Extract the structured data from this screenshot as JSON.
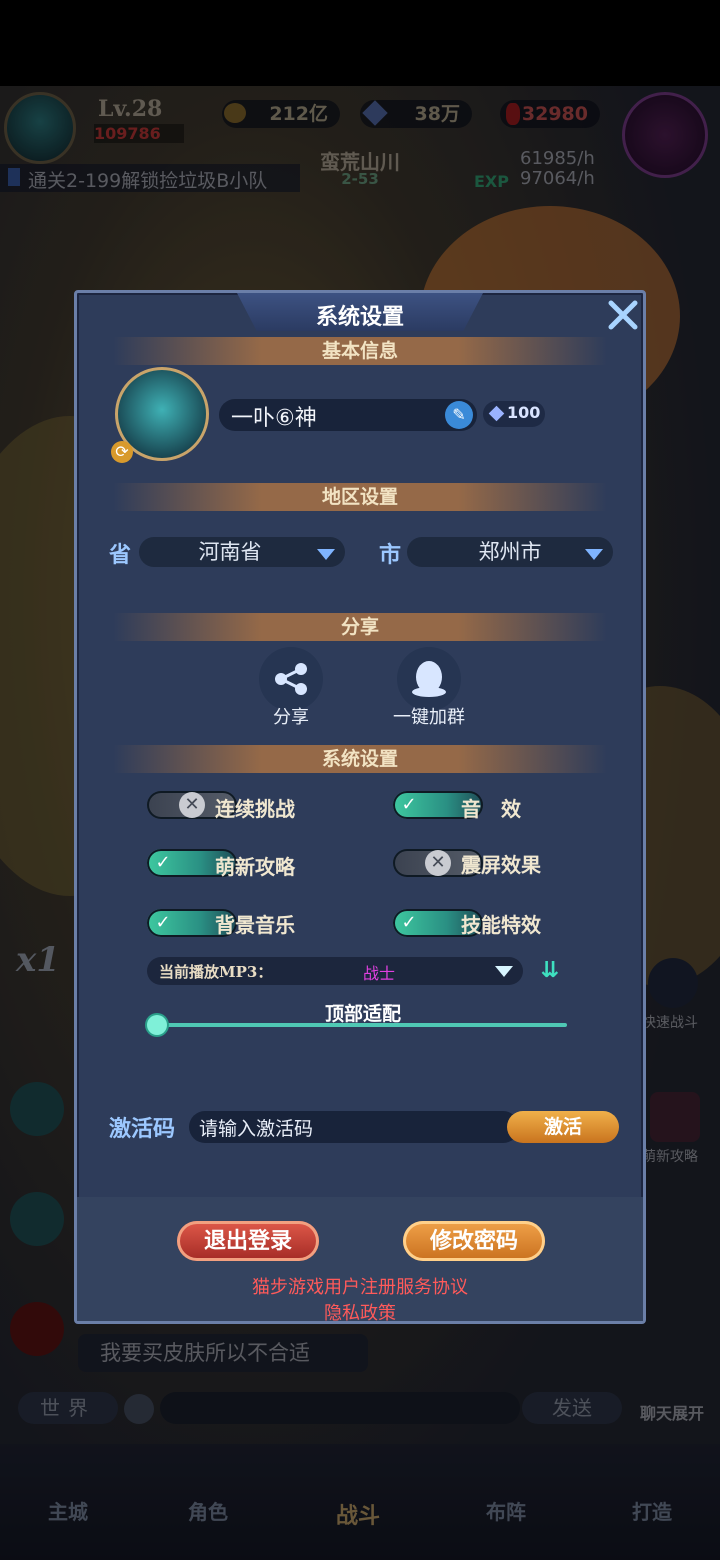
{
  "hud": {
    "level": "Lv.28",
    "power": "109786",
    "gold": "212亿",
    "diamonds": "38万",
    "rubies": "32980",
    "quest": "通关2-199解锁捡垃圾B小队",
    "stage_name": "蛮荒山川",
    "stage_num": "2-53",
    "gold_rate": "61985/h",
    "exp_label": "EXP",
    "exp_rate": "97064/h"
  },
  "side": {
    "speed": "x1",
    "fast_battle": "快速战斗",
    "guide": "萌新攻略",
    "chat_expand": "聊天展开"
  },
  "chat": {
    "message": "我要买皮肤所以不合适",
    "channel": "世界",
    "send": "发送"
  },
  "bottom_nav": [
    "主城",
    "角色",
    "战斗",
    "布阵",
    "打造"
  ],
  "dialog": {
    "title": "系统设置",
    "basic_info": "基本信息",
    "nickname": "一卟⑥神",
    "rename_cost": "100",
    "region_title": "地区设置",
    "province_label": "省",
    "province": "河南省",
    "city_label": "市",
    "city": "郑州市",
    "share_title": "分享",
    "share_label": "分享",
    "join_group_label": "一键加群",
    "settings_title": "系统设置",
    "toggles": [
      {
        "label": "连续挑战",
        "on": false
      },
      {
        "label": "音　效",
        "on": true
      },
      {
        "label": "萌新攻略",
        "on": true
      },
      {
        "label": "震屏效果",
        "on": false
      },
      {
        "label": "背景音乐",
        "on": true
      },
      {
        "label": "技能特效",
        "on": true
      }
    ],
    "music_label": "当前播放MP3：",
    "music_track": "战士",
    "top_adapt": "顶部适配",
    "top_adapt_level": 0,
    "code_label": "激活码",
    "code_placeholder": "请输入激活码",
    "activate": "激活",
    "logout": "退出登录",
    "change_password": "修改密码",
    "agreement": "猫步游戏用户注册服务协议",
    "privacy": "隐私政策"
  }
}
